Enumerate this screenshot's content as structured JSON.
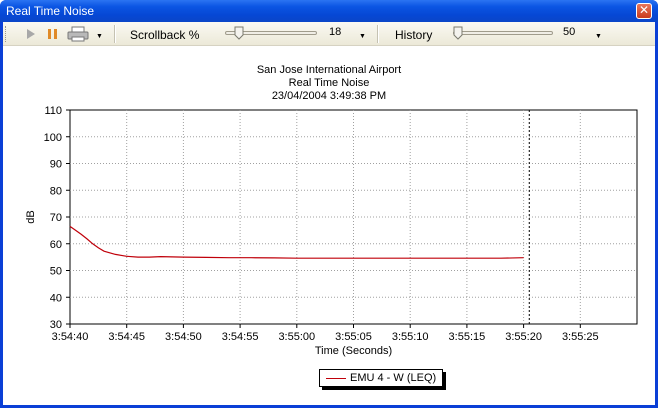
{
  "window": {
    "title": "Real Time Noise",
    "close_glyph": "✕"
  },
  "toolbar": {
    "play_icon": "play-icon",
    "pause_icon": "pause-icon",
    "print_icon": "printer-icon",
    "scrollback_label": "Scrollback %",
    "scrollback_value": "18",
    "history_label": "History",
    "history_value": "50",
    "dropdown_glyph": "▼"
  },
  "chart_header": {
    "line1": "San Jose International Airport",
    "line2": "Real Time Noise",
    "line3": "23/04/2004 3:49:38 PM"
  },
  "colors": {
    "series": "#c0000a",
    "grid": "#a0a0a0"
  },
  "chart_data": {
    "type": "line",
    "title": "San Jose International Airport",
    "xlabel": "Time (Seconds)",
    "ylabel": "dB",
    "ylim": [
      30,
      110
    ],
    "yticks": [
      "30",
      "40",
      "50",
      "60",
      "70",
      "80",
      "90",
      "100",
      "110"
    ],
    "xticks": [
      "3:54:40",
      "3:54:45",
      "3:54:50",
      "3:54:55",
      "3:55:00",
      "3:55:05",
      "3:55:10",
      "3:55:15",
      "3:55:20",
      "3:55:25"
    ],
    "xlim_seconds": [
      0,
      50
    ],
    "cursor_seconds": 40.5,
    "grid": true,
    "legend": "bottom-center",
    "series": [
      {
        "name": "EMU 4 - W (LEQ)",
        "x": [
          0,
          0.5,
          1,
          1.5,
          2,
          2.5,
          3,
          4,
          5,
          6,
          7,
          8,
          10,
          12,
          14,
          16,
          18,
          20,
          22,
          24,
          26,
          28,
          30,
          32,
          34,
          36,
          38,
          40
        ],
        "values": [
          66.5,
          65,
          63.5,
          61.8,
          60,
          58.5,
          57.2,
          56,
          55.3,
          55,
          55,
          55.2,
          55,
          54.9,
          54.8,
          54.8,
          54.7,
          54.6,
          54.6,
          54.6,
          54.6,
          54.6,
          54.6,
          54.6,
          54.6,
          54.6,
          54.6,
          54.8
        ]
      }
    ]
  }
}
